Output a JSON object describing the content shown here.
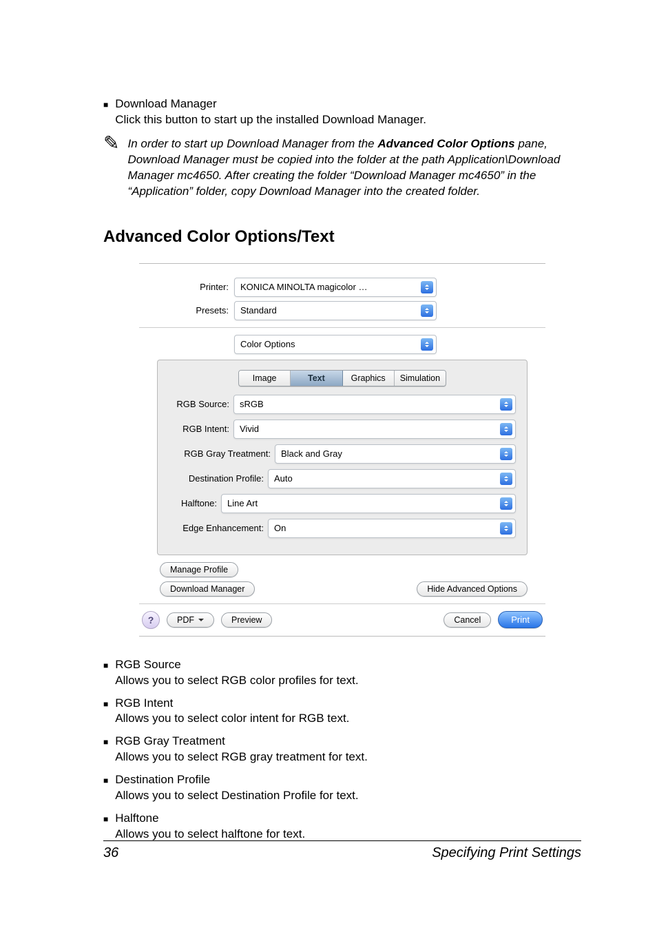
{
  "top_bullet": {
    "title": "Download Manager",
    "desc": "Click this button to start up the installed Download Manager."
  },
  "note": {
    "pre": "In order to start up Download Manager from the ",
    "bold1": "Advanced Color Options",
    "rest": " pane, Download Manager must be copied into the folder at the path Application\\Download Manager mc4650. After creating the folder “Download Manager mc4650” in the “Application” folder, copy Download Manager into the created folder."
  },
  "heading": "Advanced Color Options/Text",
  "dlg": {
    "printer_label": "Printer:",
    "printer_value": "KONICA MINOLTA magicolor …",
    "presets_label": "Presets:",
    "presets_value": "Standard",
    "pane_value": "Color Options",
    "tabs": {
      "image": "Image",
      "text": "Text",
      "graphics": "Graphics",
      "simulation": "Simulation"
    },
    "rgb_source_label": "RGB Source:",
    "rgb_source_value": "sRGB",
    "rgb_intent_label": "RGB Intent:",
    "rgb_intent_value": "Vivid",
    "rgb_gray_label": "RGB Gray Treatment:",
    "rgb_gray_value": "Black and Gray",
    "dest_label": "Destination Profile:",
    "dest_value": "Auto",
    "halftone_label": "Halftone:",
    "halftone_value": "Line Art",
    "edge_label": "Edge Enhancement:",
    "edge_value": "On",
    "manage_profile": "Manage Profile",
    "download_manager": "Download Manager",
    "hide_adv": "Hide Advanced Options",
    "help": "?",
    "pdf": "PDF",
    "preview": "Preview",
    "cancel": "Cancel",
    "print": "Print"
  },
  "bottom": [
    {
      "title": "RGB Source",
      "desc": "Allows you to select RGB color profiles for text."
    },
    {
      "title": "RGB Intent",
      "desc": "Allows you to select color intent for RGB text."
    },
    {
      "title": "RGB Gray Treatment",
      "desc": "Allows you to select RGB gray treatment for text."
    },
    {
      "title": "Destination Profile",
      "desc": "Allows you to select Destination Profile for text."
    },
    {
      "title": "Halftone",
      "desc": "Allows you to select halftone for text."
    }
  ],
  "footer": {
    "page": "36",
    "section": "Specifying Print Settings"
  }
}
